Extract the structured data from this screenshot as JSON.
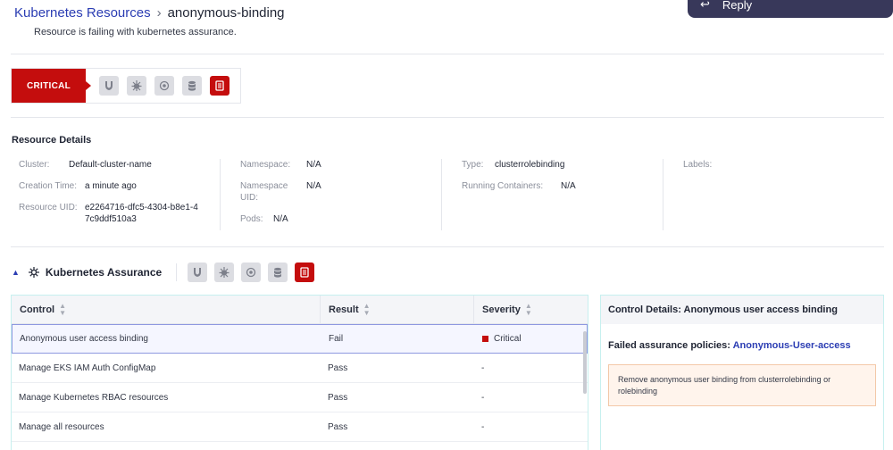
{
  "breadcrumb": {
    "parent": "Kubernetes Resources",
    "separator": "›",
    "current": "anonymous-binding"
  },
  "reply_button": {
    "label": "Reply"
  },
  "description": "Resource is failing with kubernetes assurance.",
  "severity": {
    "label": "CRITICAL",
    "color": "#c40d0d"
  },
  "icons": [
    "vulnerability-icon",
    "malware-icon",
    "sensitive-data-icon",
    "database-icon",
    "assurance-doc-icon"
  ],
  "resource_details": {
    "title": "Resource Details",
    "cluster": {
      "label": "Cluster:",
      "value": "Default-cluster-name"
    },
    "creation_time": {
      "label": "Creation Time:",
      "value": "a minute ago"
    },
    "resource_uid": {
      "label": "Resource UID:",
      "value": "e2264716-dfc5-4304-b8e1-47c9ddf510a3"
    },
    "namespace": {
      "label": "Namespace:",
      "value": "N/A"
    },
    "namespace_uid": {
      "label": "Namespace UID:",
      "value": "N/A"
    },
    "pods": {
      "label": "Pods:",
      "value": "N/A"
    },
    "type": {
      "label": "Type:",
      "value": "clusterrolebinding"
    },
    "running_containers": {
      "label": "Running Containers:",
      "value": "N/A"
    },
    "labels": {
      "label": "Labels:"
    }
  },
  "assurance": {
    "title": "Kubernetes Assurance",
    "columns": [
      "Control",
      "Result",
      "Severity"
    ],
    "rows": [
      {
        "control": "Anonymous user access binding",
        "result": "Fail",
        "severity": "Critical"
      },
      {
        "control": "Manage EKS IAM Auth ConfigMap",
        "result": "Pass",
        "severity": "-"
      },
      {
        "control": "Manage Kubernetes RBAC resources",
        "result": "Pass",
        "severity": "-"
      },
      {
        "control": "Manage all resources",
        "result": "Pass",
        "severity": "-"
      }
    ]
  },
  "control_details": {
    "title": "Control Details: Anonymous user access binding",
    "policies_label": "Failed assurance policies:",
    "policy_link": "Anonymous-User-access",
    "remediation": "Remove anonymous user binding from clusterrolebinding or rolebinding"
  },
  "colors": {
    "accent": "#2b3db3",
    "critical": "#c40d0d",
    "reply_bg": "#38385a"
  }
}
